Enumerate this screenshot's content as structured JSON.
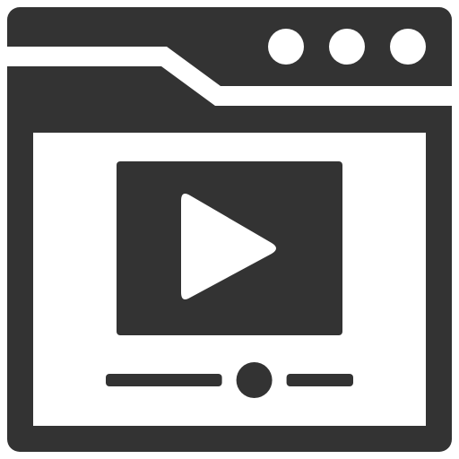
{
  "icon": {
    "semantic": "video-player-window-icon",
    "parts": [
      "browser-window-frame",
      "window-tab",
      "window-control-dots",
      "video-screen",
      "play-icon",
      "seek-bar",
      "seek-handle"
    ]
  },
  "colors": {
    "frame": "#333333",
    "background": "#ffffff",
    "content": "#ffffff",
    "accent": "#333333"
  },
  "player": {
    "progress_fraction": 0.6
  },
  "window_controls": {
    "count": 3
  }
}
